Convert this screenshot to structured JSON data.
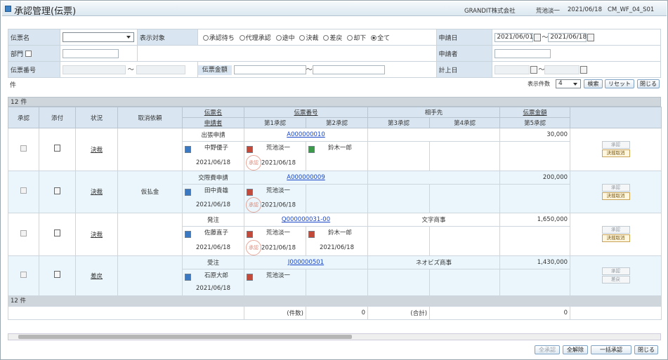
{
  "window": {
    "title": "承認管理(伝票)",
    "company": "GRANDIT株式会社",
    "user": "荒池淡一",
    "date": "2021/06/18",
    "screen_id": "CM_WF_04_S01"
  },
  "filters": {
    "slip_name_label": "伝票名",
    "display_target_label": "表示対象",
    "display_options": [
      "承認待ち",
      "代理承認",
      "途中",
      "決裁",
      "差戻",
      "却下",
      "全て"
    ],
    "apply_date_label": "申請日",
    "apply_date_from": "2021/06/01",
    "apply_date_to": "2021/06/18",
    "dept_label": "部門",
    "applicant_label": "申請者",
    "slip_no_label": "伝票番号",
    "slip_amount_label": "伝票金額",
    "posting_date_label": "計上日",
    "tilde": "～",
    "other_label": "件",
    "display_count_label": "表示件数",
    "display_count_value": "4",
    "search_button": "検索",
    "reset_button": "リセット",
    "close_button": "閉じる"
  },
  "grid": {
    "count_top": "12 件",
    "count_bottom": "12 件",
    "headers": {
      "approve": "承認",
      "attach": "添付",
      "status": "状況",
      "cancel_reason": "取消依頼",
      "slip_name": "伝票名",
      "applicant": "申請者",
      "slip_no": "伝票番号",
      "approval1": "第1承認",
      "approval2": "第2承認",
      "partner": "相手先",
      "approval3": "第3承認",
      "approval4": "第4承認",
      "slip_amount": "伝票金額",
      "approval5": "第5承認"
    },
    "rows": [
      {
        "status": "決裁",
        "cancel": "",
        "slip_name": "出張申請",
        "slip_no": "A000000010",
        "partner": "",
        "amount": "30,000",
        "applicant": "中野優子",
        "apply_date": "2021/06/18",
        "a1_name": "荒池淡一",
        "a1_date": "2021/06/18",
        "a1_stamp": "承認",
        "a2_name": "鈴木一郎",
        "a2_date": "",
        "btn1": "承認",
        "btn2": "決裁取消"
      },
      {
        "status": "決裁",
        "cancel": "仮払金",
        "slip_name": "交際費申請",
        "slip_no": "A000000009",
        "partner": "",
        "amount": "200,000",
        "applicant": "田中貴雄",
        "apply_date": "2021/06/18",
        "a1_name": "荒池淡一",
        "a1_date": "2021/06/18",
        "a1_stamp": "承認",
        "a2_name": "",
        "a2_date": "",
        "btn1": "承認",
        "btn2": "決裁取消"
      },
      {
        "status": "決裁",
        "cancel": "",
        "slip_name": "発注",
        "slip_no": "Q000000031-00",
        "partner": "文字商事",
        "amount": "1,650,000",
        "applicant": "佐藤直子",
        "apply_date": "2021/06/18",
        "a1_name": "荒池淡一",
        "a1_date": "2021/06/18",
        "a1_stamp": "承認",
        "a2_name": "鈴木一郎",
        "a2_date": "2021/06/18",
        "btn1": "承認",
        "btn2": "決裁取消"
      },
      {
        "status": "差戻",
        "cancel": "",
        "slip_name": "受注",
        "slip_no": "J000000501",
        "partner": "ネオビズ商事",
        "amount": "1,430,000",
        "applicant": "石原大郎",
        "apply_date": "2021/06/18",
        "a1_name": "荒池淡一",
        "a1_date": "",
        "a1_stamp": "",
        "a2_name": "",
        "a2_date": "",
        "btn1": "承認",
        "btn2": "差戻"
      }
    ],
    "footer": {
      "count_label": "(件数)",
      "count_value": "0",
      "total_label": "(合計)",
      "total_value": "0"
    }
  },
  "bottom_buttons": {
    "approve_all": "全承認",
    "clear": "全解除",
    "bulk_approve": "一括承認",
    "close": "閉じる"
  },
  "colors": {
    "header_bg": "#d9e6f1",
    "accent": "#3b7fc4",
    "link": "#1a46c8"
  }
}
